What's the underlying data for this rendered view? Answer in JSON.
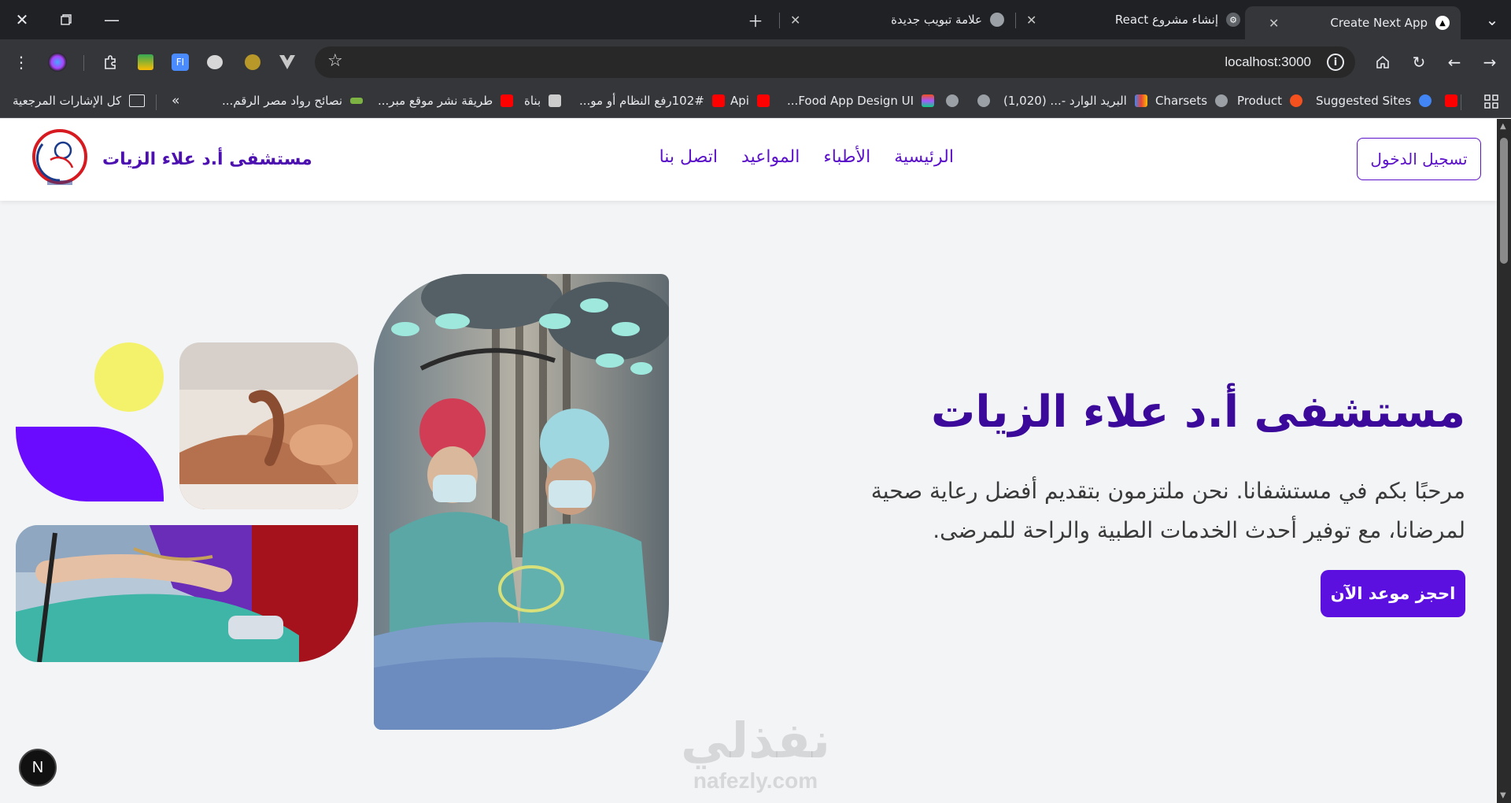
{
  "browser": {
    "tabs": [
      {
        "title": "Create Next App",
        "active": true
      },
      {
        "title": "إنشاء مشروع React",
        "active": false
      },
      {
        "title": "علامة تبويب جديدة",
        "active": false
      }
    ],
    "url": "localhost:3000",
    "bookmarks": [
      {
        "label": "Suggested Sites",
        "color": "#4285f4"
      },
      {
        "label": "Product",
        "color": "#f4511e"
      },
      {
        "label": "Charsets",
        "color": "#9aa0a6"
      },
      {
        "label": "البريد الوارد -... (1,020)",
        "color": "#ea4335"
      },
      {
        "label": "Food App Design UI...",
        "color": "#a259ff"
      },
      {
        "label": "Api",
        "color": "#ff0000"
      },
      {
        "label": "102#رفع النظام أو مو...",
        "color": "#ff0000"
      },
      {
        "label": "بناة",
        "color": "#cccccc"
      },
      {
        "label": "طريقة نشر موقع مبر...",
        "color": "#ff0000"
      },
      {
        "label": "نصائح رواد مصر الرقم...",
        "color": "#7cb342"
      },
      {
        "label": "كل الإشارات المرجعية",
        "color": "#e8eaed"
      }
    ]
  },
  "site": {
    "brand_name": "مستشفى أ.د علاء الزيات",
    "login_label": "تسجيل الدخول",
    "nav": [
      "الرئيسية",
      "الأطباء",
      "المواعيد",
      "اتصل بنا"
    ],
    "hero": {
      "title": "مستشفى أ.د علاء الزيات",
      "text": "مرحبًا بكم في مستشفانا. نحن ملتزمون بتقديم أفضل رعاية صحية لمرضانا، مع توفير أحدث الخدمات الطبية والراحة للمرضى.",
      "cta_label": "احجز موعد الآن"
    },
    "accent_color": "#5b10e0",
    "yellow_color": "#f4f26a"
  },
  "dev_badge": "N",
  "watermark": {
    "arabic": "نفذلي",
    "latin": "nafezly.com"
  }
}
